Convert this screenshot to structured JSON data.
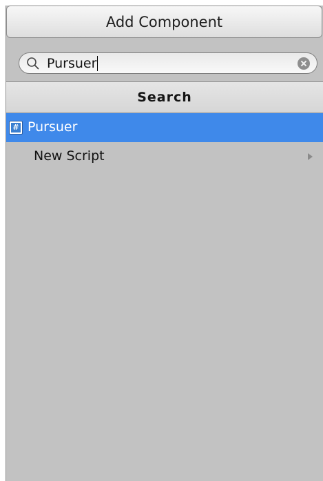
{
  "header": {
    "add_component_label": "Add Component"
  },
  "search": {
    "value": "Pursuer",
    "icon": "search-icon",
    "clear_icon": "clear-icon"
  },
  "section": {
    "title": "Search"
  },
  "list": {
    "items": [
      {
        "label": "Pursuer",
        "icon": "csharp-script-icon",
        "selected": true
      },
      {
        "label": "New Script",
        "icon": "chevron-right-icon",
        "selected": false
      }
    ]
  },
  "colors": {
    "panel_bg": "#c2c2c2",
    "selection": "#3f89ea"
  }
}
